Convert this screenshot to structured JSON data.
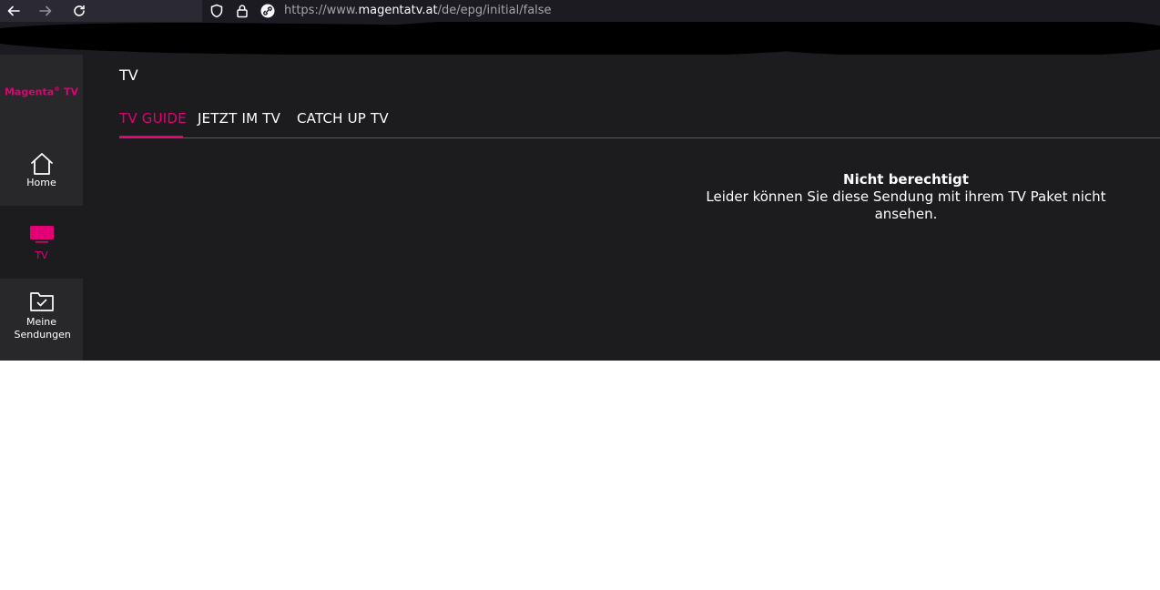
{
  "browser": {
    "url_prefix": "https://www.",
    "url_domain": "magentatv.at",
    "url_path": "/de/epg/initial/false"
  },
  "app": {
    "logo_text": "Magenta",
    "logo_reg": "®",
    "logo_suffix": " TV",
    "brand_color": "#e20074"
  },
  "sidebar": {
    "items": [
      {
        "label": "Home",
        "icon": "home-icon",
        "active": false
      },
      {
        "label": "TV",
        "icon": "tv-icon",
        "active": true
      },
      {
        "label": "Meine Sendungen",
        "icon": "folder-check-icon",
        "active": false
      }
    ]
  },
  "header": {
    "title": "TV"
  },
  "tabs": [
    {
      "label": "TV GUIDE",
      "active": true
    },
    {
      "label": "JETZT IM TV",
      "active": false
    },
    {
      "label": "CATCH UP TV",
      "active": false
    }
  ],
  "notice": {
    "title": "Nicht berechtigt",
    "text": "Leider können Sie diese Sendung mit ihrem TV Paket nicht ansehen."
  }
}
